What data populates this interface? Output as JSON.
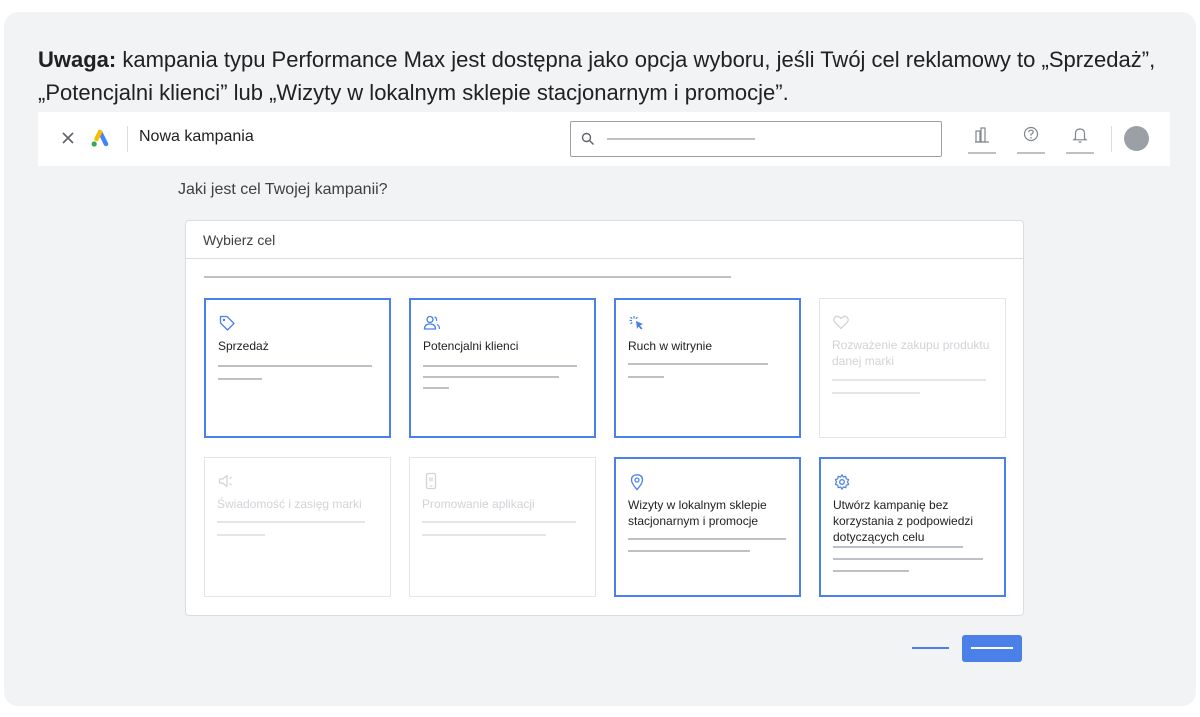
{
  "note": {
    "bold": "Uwaga:",
    "text": " kampania typu Performance Max jest dostępna jako opcja wyboru, jeśli Twój cel reklamowy to „Sprzedaż”, „Potencjalni klienci” lub „Wizyty w lokalnym sklepie stacjonarnym i promocje”."
  },
  "appbar": {
    "title": "Nowa kampania",
    "icons": [
      "close-icon",
      "google-ads-logo",
      "search-icon",
      "reports-icon",
      "help-icon",
      "notifications-icon",
      "avatar"
    ]
  },
  "question": "Jaki jest cel Twojej kampanii?",
  "panel": {
    "header": "Wybierz cel",
    "goals": [
      {
        "label": "Sprzedaż",
        "icon": "tag-icon",
        "enabled": true
      },
      {
        "label": "Potencjalni klienci",
        "icon": "people-icon",
        "enabled": true
      },
      {
        "label": "Ruch w witrynie",
        "icon": "cursor-click-icon",
        "enabled": true
      },
      {
        "label": "Rozważenie zakupu produktu danej marki",
        "icon": "heart-icon",
        "enabled": false
      },
      {
        "label": "Świadomość i zasięg marki",
        "icon": "speaker-icon",
        "enabled": false
      },
      {
        "label": "Promowanie aplikacji",
        "icon": "phone-icon",
        "enabled": false
      },
      {
        "label": "Wizyty w lokalnym sklepie stacjonarnym i promocje",
        "icon": "location-pin-icon",
        "enabled": true
      },
      {
        "label": "Utwórz kampanię bez korzystania z podpowiedzi dotyczących celu",
        "icon": "gear-icon",
        "enabled": true
      }
    ]
  },
  "colors": {
    "accent": "#4a80e8",
    "background": "#f1f3f4",
    "placeholder": "#bdc1c6",
    "disabled": "#e3e5e8"
  }
}
